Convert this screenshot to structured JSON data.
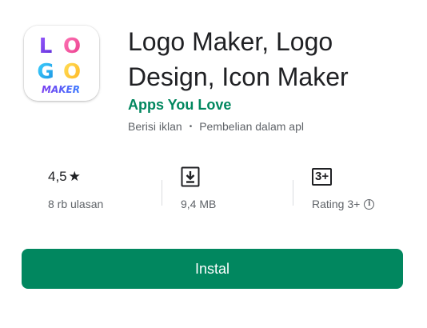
{
  "app": {
    "title": "Logo Maker, Logo Design, Icon Maker",
    "developer": "Apps You Love",
    "contains_ads": "Berisi iklan",
    "separator": "•",
    "in_app_purchases": "Pembelian dalam apl",
    "icon": {
      "letters": [
        "L",
        "O",
        "G",
        "O"
      ],
      "sublabel": "MAKER",
      "colors": [
        "#7a3cf0",
        "#ff4fa0",
        "#27c0ff",
        "#ffd23a"
      ]
    }
  },
  "stats": {
    "rating": "4,5",
    "rating_icon": "star-icon",
    "reviews": "8 rb ulasan",
    "size_icon": "download-icon",
    "size": "9,4 MB",
    "content_rating_badge": "3+",
    "content_rating": "Rating 3+",
    "content_rating_info_icon": "info-icon",
    "info_glyph": "i"
  },
  "install": {
    "label": "Instal"
  },
  "colors": {
    "accent": "#01875f",
    "text_primary": "#202124",
    "text_secondary": "#5f6368"
  }
}
